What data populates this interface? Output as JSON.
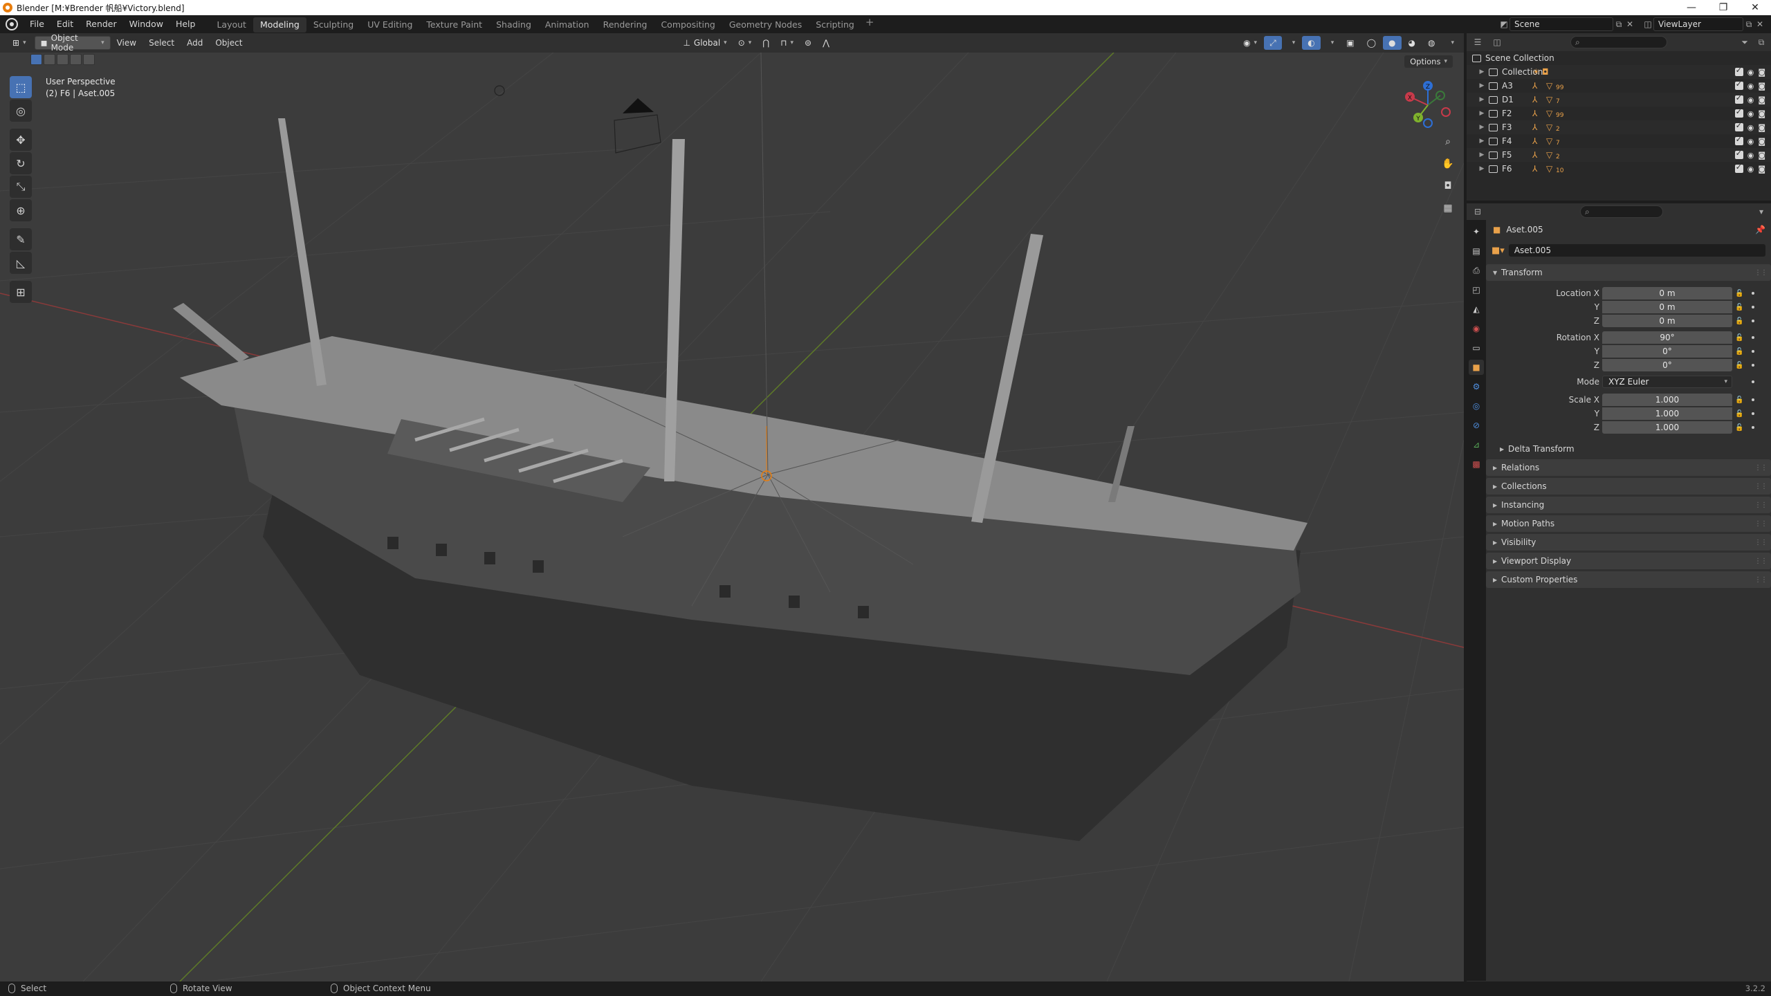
{
  "window": {
    "title": "Blender [M:¥Brender 帆船¥Victory.blend]",
    "buttons": [
      "—",
      "❐",
      "✕"
    ]
  },
  "menu": [
    "File",
    "Edit",
    "Render",
    "Window",
    "Help"
  ],
  "workspaces": [
    {
      "label": "Layout",
      "active": false
    },
    {
      "label": "Modeling",
      "active": true
    },
    {
      "label": "Sculpting",
      "active": false
    },
    {
      "label": "UV Editing",
      "active": false
    },
    {
      "label": "Texture Paint",
      "active": false
    },
    {
      "label": "Shading",
      "active": false
    },
    {
      "label": "Animation",
      "active": false
    },
    {
      "label": "Rendering",
      "active": false
    },
    {
      "label": "Compositing",
      "active": false
    },
    {
      "label": "Geometry Nodes",
      "active": false
    },
    {
      "label": "Scripting",
      "active": false
    }
  ],
  "add_workspace": "+",
  "scene": {
    "name": "Scene",
    "view_layer": "ViewLayer"
  },
  "viewport_header": {
    "mode": "Object Mode",
    "menus": [
      "View",
      "Select",
      "Add",
      "Object"
    ],
    "transform_orientation": "Global",
    "options_label": "Options"
  },
  "viewport": {
    "perspective": "User Perspective",
    "object_info": "(2) F6 | Aset.005",
    "axis_labels": {
      "x": "X",
      "y": "Y",
      "z": "Z"
    }
  },
  "outliner": {
    "root": "Scene Collection",
    "items": [
      {
        "name": "Collection",
        "count": ""
      },
      {
        "name": "A3",
        "count": "99"
      },
      {
        "name": "D1",
        "count": "7"
      },
      {
        "name": "F2",
        "count": "99"
      },
      {
        "name": "F3",
        "count": "2"
      },
      {
        "name": "F4",
        "count": "7"
      },
      {
        "name": "F5",
        "count": "2"
      },
      {
        "name": "F6",
        "count": "10"
      }
    ]
  },
  "properties": {
    "context_object": "Aset.005",
    "object_name": "Aset.005",
    "transform": {
      "title": "Transform",
      "location_label": "Location X",
      "location": [
        "0 m",
        "0 m",
        "0 m"
      ],
      "rotation_label": "Rotation X",
      "rotation": [
        "90°",
        "0°",
        "0°"
      ],
      "mode_label": "Mode",
      "mode": "XYZ Euler",
      "scale_label": "Scale X",
      "scale": [
        "1.000",
        "1.000",
        "1.000"
      ],
      "y_label": "Y",
      "z_label": "Z",
      "delta": "Delta Transform"
    },
    "panels": [
      "Relations",
      "Collections",
      "Instancing",
      "Motion Paths",
      "Visibility",
      "Viewport Display",
      "Custom Properties"
    ]
  },
  "statusbar": {
    "select": "Select",
    "rotate": "Rotate View",
    "context_menu": "Object Context Menu",
    "version": "3.2.2"
  },
  "colors": {
    "accent": "#4772b3",
    "viewport_bg": "#3c3c3c",
    "object_orange": "#e9a14a"
  }
}
